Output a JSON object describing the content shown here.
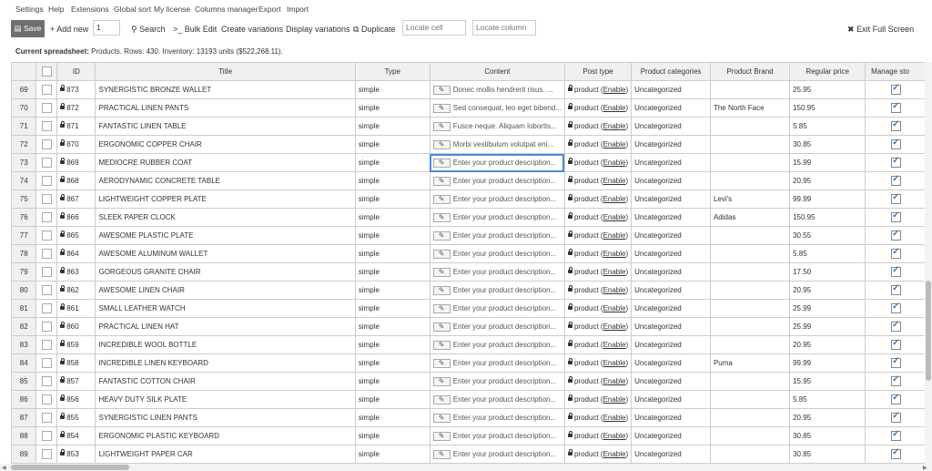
{
  "menu": [
    "Settings",
    "Help",
    "Extensions",
    "Global sort",
    "My license",
    "Columns manager",
    "Export",
    "Import"
  ],
  "toolbar": {
    "save": "Save",
    "add_new": "Add new",
    "add_count": "1",
    "search": "Search",
    "bulk_edit": "Bulk Edit",
    "create_variations": "Create variations",
    "display_variations": "Display variations",
    "duplicate": "Duplicate",
    "locate_cell_placeholder": "Locate cell",
    "locate_column_placeholder": "Locate column",
    "exit_full_screen": "Exit Full Screen"
  },
  "summary": {
    "label": "Current spreadsheet:",
    "text": "Products. Rows: 430. Inventory: 13193 units ($522,268.11)."
  },
  "columns": [
    "ID",
    "Title",
    "Type",
    "Content",
    "Post type",
    "Product categories",
    "Product Brand",
    "Regular price",
    "Manage sto"
  ],
  "post_type_prefix": "product (",
  "post_type_link": "Enable",
  "post_type_suffix": ")",
  "rows": [
    {
      "num": "69",
      "id": "873",
      "title": "SYNERGISTIC BRONZE WALLET",
      "type": "simple",
      "content": "Donec mollis hendrerit risus. ...",
      "category": "Uncategorized",
      "brand": "",
      "price": "25.95"
    },
    {
      "num": "70",
      "id": "872",
      "title": "PRACTICAL LINEN PANTS",
      "type": "simple",
      "content": "Sed consequat, leo eget bibend...",
      "category": "Uncategorized",
      "brand": "The North Face",
      "price": "150.95"
    },
    {
      "num": "71",
      "id": "871",
      "title": "FANTASTIC LINEN TABLE",
      "type": "simple",
      "content": "Fusce neque. Aliquam lobortis...",
      "category": "Uncategorized",
      "brand": "",
      "price": "5.85"
    },
    {
      "num": "72",
      "id": "870",
      "title": "ERGONOMIC COPPER CHAIR",
      "type": "simple",
      "content": "Morbi vestibulum volutpat eni...",
      "category": "Uncategorized",
      "brand": "",
      "price": "30.85"
    },
    {
      "num": "73",
      "id": "869",
      "title": "MEDIOCRE RUBBER COAT",
      "type": "simple",
      "content": "Enter your product description...",
      "category": "Uncategorized",
      "brand": "",
      "price": "15.99"
    },
    {
      "num": "74",
      "id": "868",
      "title": "AERODYNAMIC CONCRETE TABLE",
      "type": "simple",
      "content": "Enter your product description...",
      "category": "Uncategorized",
      "brand": "",
      "price": "20.95"
    },
    {
      "num": "75",
      "id": "867",
      "title": "LIGHTWEIGHT COPPER PLATE",
      "type": "simple",
      "content": "Enter your product description...",
      "category": "Uncategorized",
      "brand": "Levi's",
      "price": "99.99"
    },
    {
      "num": "76",
      "id": "866",
      "title": "SLEEK PAPER CLOCK",
      "type": "simple",
      "content": "Enter your product description...",
      "category": "Uncategorized",
      "brand": "Adidas",
      "price": "150.95"
    },
    {
      "num": "77",
      "id": "865",
      "title": "AWESOME PLASTIC PLATE",
      "type": "simple",
      "content": "Enter your product description...",
      "category": "Uncategorized",
      "brand": "",
      "price": "30.55"
    },
    {
      "num": "78",
      "id": "864",
      "title": "AWESOME ALUMINUM WALLET",
      "type": "simple",
      "content": "Enter your product description...",
      "category": "Uncategorized",
      "brand": "",
      "price": "5.85"
    },
    {
      "num": "79",
      "id": "863",
      "title": "GORGEOUS GRANITE CHAIR",
      "type": "simple",
      "content": "Enter your product description...",
      "category": "Uncategorized",
      "brand": "",
      "price": "17.50"
    },
    {
      "num": "80",
      "id": "862",
      "title": "AWESOME LINEN CHAIR",
      "type": "simple",
      "content": "Enter your product description...",
      "category": "Uncategorized",
      "brand": "",
      "price": "20.95"
    },
    {
      "num": "81",
      "id": "861",
      "title": "SMALL LEATHER WATCH",
      "type": "simple",
      "content": "Enter your product description...",
      "category": "Uncategorized",
      "brand": "",
      "price": "25.99"
    },
    {
      "num": "82",
      "id": "860",
      "title": "PRACTICAL LINEN HAT",
      "type": "simple",
      "content": "Enter your product description...",
      "category": "Uncategorized",
      "brand": "",
      "price": "25.99"
    },
    {
      "num": "83",
      "id": "859",
      "title": "INCREDIBLE WOOL BOTTLE",
      "type": "simple",
      "content": "Enter your product description...",
      "category": "Uncategorized",
      "brand": "",
      "price": "20.95"
    },
    {
      "num": "84",
      "id": "858",
      "title": "INCREDIBLE LINEN KEYBOARD",
      "type": "simple",
      "content": "Enter your product description...",
      "category": "Uncategorized",
      "brand": "Puma",
      "price": "99.99"
    },
    {
      "num": "85",
      "id": "857",
      "title": "FANTASTIC COTTON CHAIR",
      "type": "simple",
      "content": "Enter your product description...",
      "category": "Uncategorized",
      "brand": "",
      "price": "15.95"
    },
    {
      "num": "86",
      "id": "856",
      "title": "HEAVY DUTY SILK PLATE",
      "type": "simple",
      "content": "Enter your product description...",
      "category": "Uncategorized",
      "brand": "",
      "price": "5.85"
    },
    {
      "num": "87",
      "id": "855",
      "title": "SYNERGISTIC LINEN PANTS",
      "type": "simple",
      "content": "Enter your product description...",
      "category": "Uncategorized",
      "brand": "",
      "price": "20.95"
    },
    {
      "num": "88",
      "id": "854",
      "title": "ERGONOMIC PLASTIC KEYBOARD",
      "type": "simple",
      "content": "Enter your product description...",
      "category": "Uncategorized",
      "brand": "",
      "price": "30.85"
    },
    {
      "num": "89",
      "id": "853",
      "title": "LIGHTWEIGHT PAPER CAR",
      "type": "simple",
      "content": "Enter your product description...",
      "category": "Uncategorized",
      "brand": "",
      "price": "30.85"
    }
  ],
  "selected_row_index": 4
}
